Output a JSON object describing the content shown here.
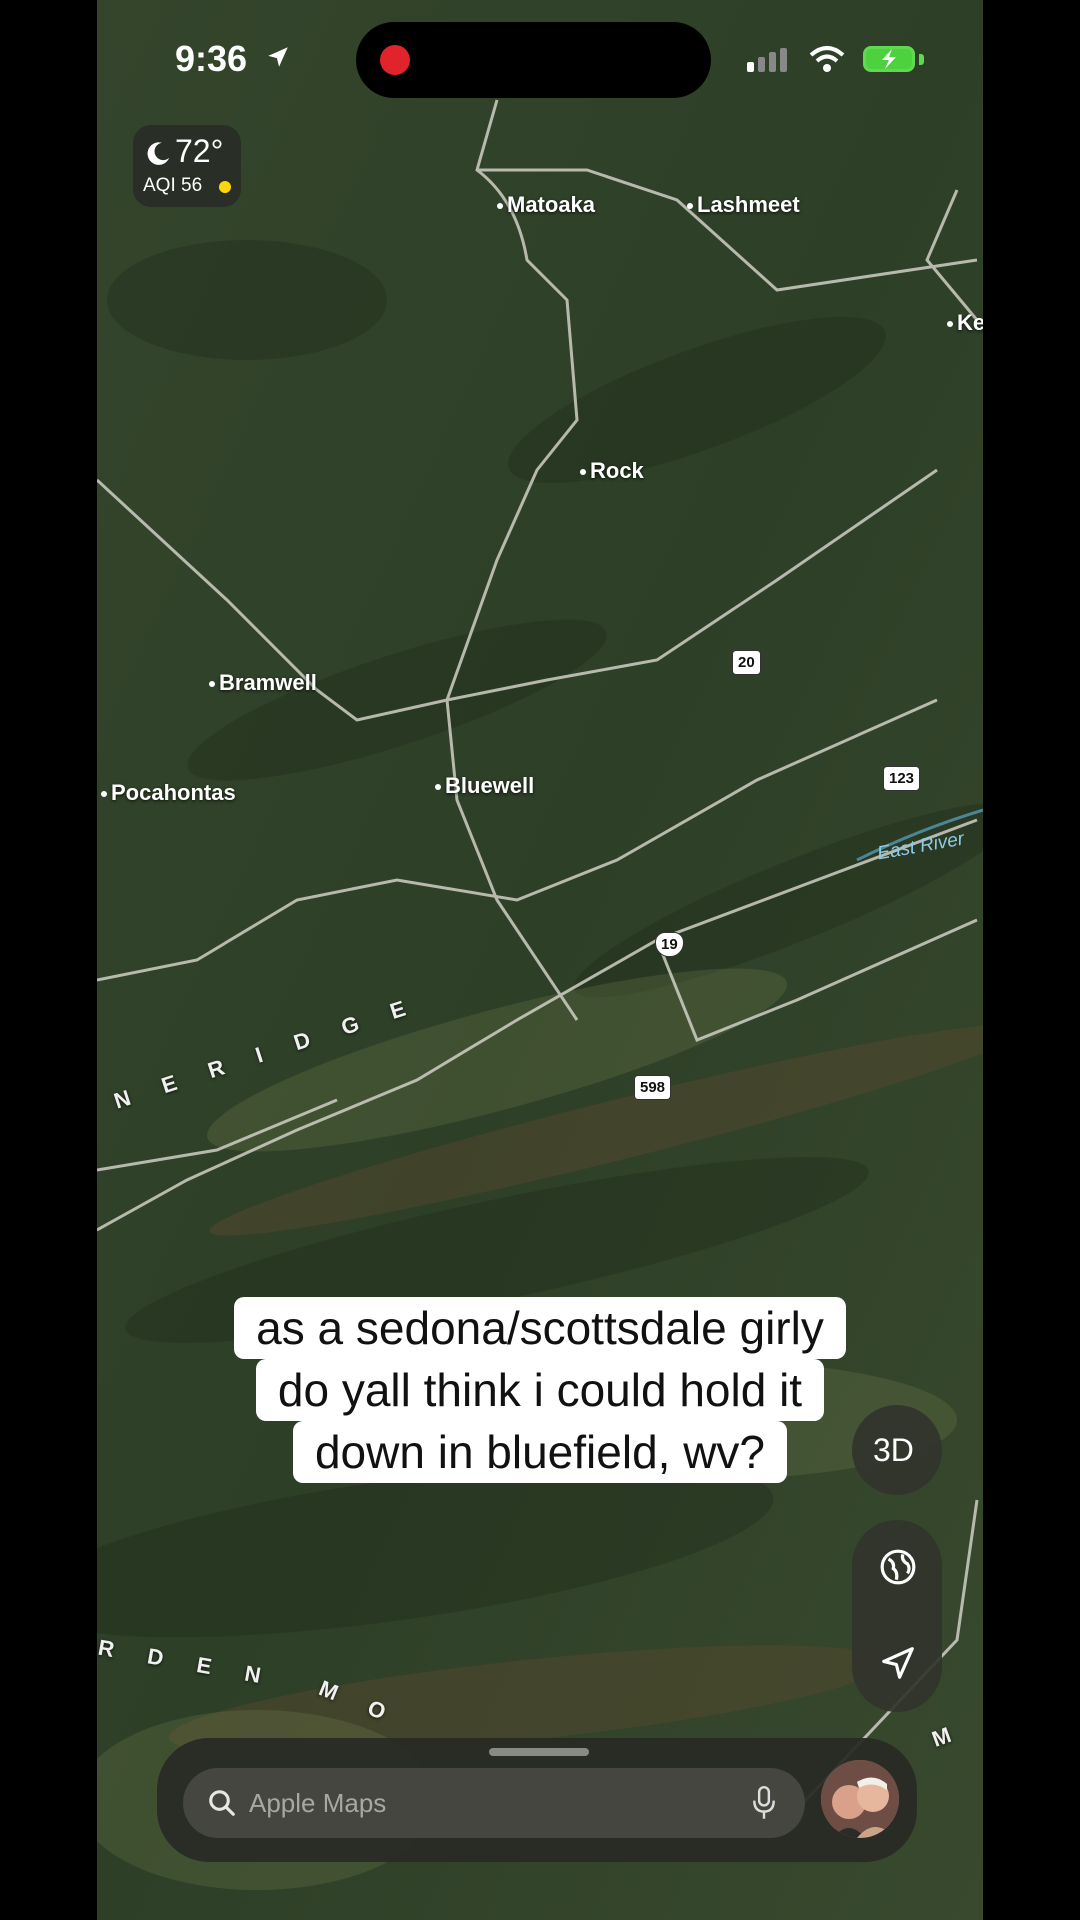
{
  "status_bar": {
    "time": "9:36"
  },
  "weather": {
    "temperature": "72°",
    "aqi": "AQI 56"
  },
  "map": {
    "places": [
      "Matoaka",
      "Lashmeet",
      "Ke",
      "Rock",
      "Bramwell",
      "Pocahontas",
      "Bluewell"
    ],
    "ridge_label_1": "N E R I D G E",
    "ridge_label_2": "R D E N",
    "ridge_label_3": "M O",
    "ridge_label_4": "M",
    "river": "East River",
    "routes": [
      "20",
      "123",
      "19",
      "598"
    ]
  },
  "caption": {
    "line1": "as a sedona/scottsdale girly",
    "line2": "do yall think i could hold it",
    "line3": "down in bluefield, wv?"
  },
  "controls": {
    "view_3d": "3D"
  },
  "search": {
    "placeholder": "Apple Maps"
  }
}
